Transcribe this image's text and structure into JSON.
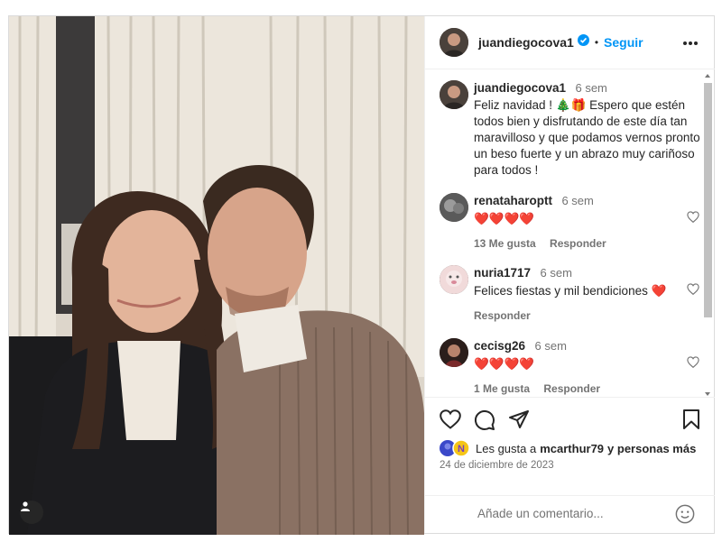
{
  "post": {
    "author": "juandiegocova1",
    "follow_label": "Seguir",
    "separator": "•"
  },
  "caption": {
    "user": "juandiegocova1",
    "time": "6 sem",
    "text": "Feliz navidad ! 🎄🎁 Espero que estén todos bien y disfrutando de este día tan maravilloso y que podamos vernos pronto un beso fuerte y un abrazo muy cariñoso para todos !"
  },
  "comments": [
    {
      "user": "renataharoptt",
      "time": "6 sem",
      "text": "❤️❤️❤️❤️",
      "likes": "13 Me gusta",
      "reply": "Responder"
    },
    {
      "user": "nuria1717",
      "time": "6 sem",
      "text": "Felices fiestas y mil bendiciones ❤️",
      "likes": "",
      "reply": "Responder"
    },
    {
      "user": "cecisg26",
      "time": "6 sem",
      "text": "❤️❤️❤️❤️",
      "likes": "1 Me gusta",
      "reply": "Responder"
    }
  ],
  "likes_line": {
    "prefix": "Les gusta a",
    "user": "mcarthur79",
    "suffix": "y personas más"
  },
  "date": "24 de diciembre de 2023",
  "comment_input": {
    "placeholder": "Añade un comentario..."
  },
  "colors": {
    "link": "#0095f6",
    "text": "#262626",
    "muted": "#737373",
    "heart": "#ed1c24"
  },
  "icons": [
    "heart-icon",
    "comment-icon",
    "share-icon",
    "bookmark-icon",
    "emoji-icon",
    "more-icon",
    "verified-icon",
    "user-tag-icon"
  ]
}
